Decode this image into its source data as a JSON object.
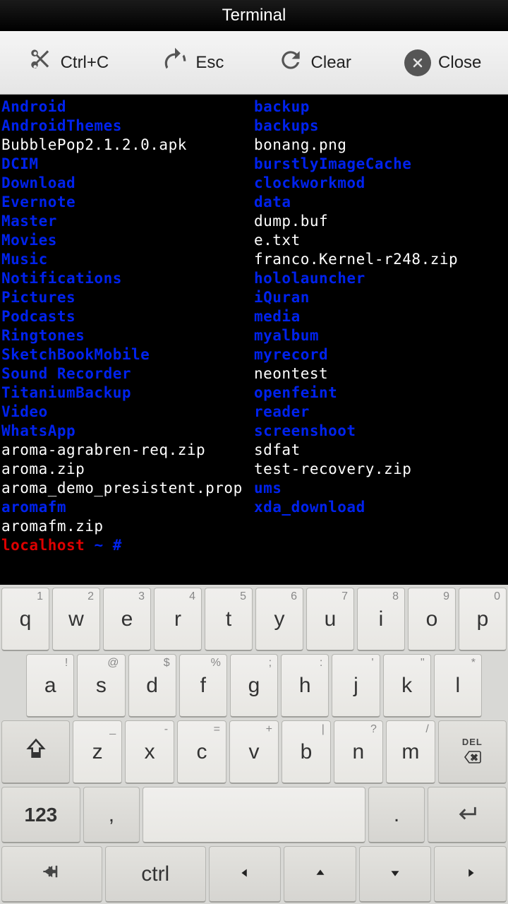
{
  "title": "Terminal",
  "toolbar": {
    "ctrlc": "Ctrl+C",
    "esc": "Esc",
    "clear": "Clear",
    "close": "Close"
  },
  "listing": [
    {
      "l": {
        "name": "Android",
        "type": "dir"
      },
      "r": {
        "name": "backup",
        "type": "dir"
      }
    },
    {
      "l": {
        "name": "AndroidThemes",
        "type": "dir"
      },
      "r": {
        "name": "backups",
        "type": "dir"
      }
    },
    {
      "l": {
        "name": "BubblePop2.1.2.0.apk",
        "type": "file"
      },
      "r": {
        "name": "bonang.png",
        "type": "file"
      }
    },
    {
      "l": {
        "name": "DCIM",
        "type": "dir"
      },
      "r": {
        "name": "burstlyImageCache",
        "type": "dir"
      }
    },
    {
      "l": {
        "name": "Download",
        "type": "dir"
      },
      "r": {
        "name": "clockworkmod",
        "type": "dir"
      }
    },
    {
      "l": {
        "name": "Evernote",
        "type": "dir"
      },
      "r": {
        "name": "data",
        "type": "dir"
      }
    },
    {
      "l": {
        "name": "Master",
        "type": "dir"
      },
      "r": {
        "name": "dump.buf",
        "type": "file"
      }
    },
    {
      "l": {
        "name": "Movies",
        "type": "dir"
      },
      "r": {
        "name": "e.txt",
        "type": "file"
      }
    },
    {
      "l": {
        "name": "Music",
        "type": "dir"
      },
      "r": {
        "name": "franco.Kernel-r248.zip",
        "type": "file"
      }
    },
    {
      "l": {
        "name": "Notifications",
        "type": "dir"
      },
      "r": {
        "name": "hololauncher",
        "type": "dir"
      }
    },
    {
      "l": {
        "name": "Pictures",
        "type": "dir"
      },
      "r": {
        "name": "iQuran",
        "type": "dir"
      }
    },
    {
      "l": {
        "name": "Podcasts",
        "type": "dir"
      },
      "r": {
        "name": "media",
        "type": "dir"
      }
    },
    {
      "l": {
        "name": "Ringtones",
        "type": "dir"
      },
      "r": {
        "name": "myalbum",
        "type": "dir"
      }
    },
    {
      "l": {
        "name": "SketchBookMobile",
        "type": "dir"
      },
      "r": {
        "name": "myrecord",
        "type": "dir"
      }
    },
    {
      "l": {
        "name": "Sound Recorder",
        "type": "dir"
      },
      "r": {
        "name": "neontest",
        "type": "file"
      }
    },
    {
      "l": {
        "name": "TitaniumBackup",
        "type": "dir"
      },
      "r": {
        "name": "openfeint",
        "type": "dir"
      }
    },
    {
      "l": {
        "name": "Video",
        "type": "dir"
      },
      "r": {
        "name": "reader",
        "type": "dir"
      }
    },
    {
      "l": {
        "name": "WhatsApp",
        "type": "dir"
      },
      "r": {
        "name": "screenshoot",
        "type": "dir"
      }
    },
    {
      "l": {
        "name": "aroma-agrabren-req.zip",
        "type": "file"
      },
      "r": {
        "name": "sdfat",
        "type": "file"
      }
    },
    {
      "l": {
        "name": "aroma.zip",
        "type": "file"
      },
      "r": {
        "name": "test-recovery.zip",
        "type": "file"
      }
    },
    {
      "l": {
        "name": "aroma_demo_presistent.prop",
        "type": "file"
      },
      "r": {
        "name": "ums",
        "type": "dir"
      }
    },
    {
      "l": {
        "name": "aromafm",
        "type": "dir"
      },
      "r": {
        "name": "xda_download",
        "type": "dir"
      }
    },
    {
      "l": {
        "name": "aromafm.zip",
        "type": "file"
      },
      "r": null
    }
  ],
  "prompt": {
    "host": "localhost",
    "path": "~",
    "symbol": "#"
  },
  "keyboard": {
    "row1": [
      {
        "main": "q",
        "sup": "1"
      },
      {
        "main": "w",
        "sup": "2"
      },
      {
        "main": "e",
        "sup": "3"
      },
      {
        "main": "r",
        "sup": "4"
      },
      {
        "main": "t",
        "sup": "5"
      },
      {
        "main": "y",
        "sup": "6"
      },
      {
        "main": "u",
        "sup": "7"
      },
      {
        "main": "i",
        "sup": "8"
      },
      {
        "main": "o",
        "sup": "9"
      },
      {
        "main": "p",
        "sup": "0"
      }
    ],
    "row2": [
      {
        "main": "a",
        "sup": "!"
      },
      {
        "main": "s",
        "sup": "@"
      },
      {
        "main": "d",
        "sup": "$"
      },
      {
        "main": "f",
        "sup": "%"
      },
      {
        "main": "g",
        "sup": ";"
      },
      {
        "main": "h",
        "sup": ":"
      },
      {
        "main": "j",
        "sup": "'"
      },
      {
        "main": "k",
        "sup": "\""
      },
      {
        "main": "l",
        "sup": "*"
      }
    ],
    "row2_tail_sup": "\\",
    "row3": [
      {
        "main": "z",
        "sup": "_"
      },
      {
        "main": "x",
        "sup": "-"
      },
      {
        "main": "c",
        "sup": "="
      },
      {
        "main": "v",
        "sup": "+"
      },
      {
        "main": "b",
        "sup": "|"
      },
      {
        "main": "n",
        "sup": "?"
      },
      {
        "main": "m",
        "sup": "/"
      }
    ],
    "del_label": "DEL",
    "numkey": "123",
    "comma": ",",
    "period": ".",
    "ctrl": "ctrl"
  }
}
